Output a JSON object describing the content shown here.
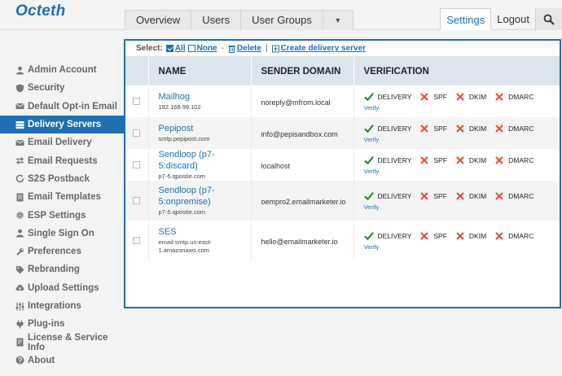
{
  "app": {
    "name": "Octeth"
  },
  "nav": {
    "items": [
      "Overview",
      "Users",
      "User Groups"
    ],
    "dropdown_glyph": "▼",
    "settings": "Settings",
    "logout": "Logout"
  },
  "sidebar": {
    "active_index": 3,
    "items": [
      {
        "label": "Admin Account",
        "icon": "user-icon"
      },
      {
        "label": "Security",
        "icon": "shield-icon"
      },
      {
        "label": "Default Opt-in Email",
        "icon": "envelope-icon"
      },
      {
        "label": "Delivery Servers",
        "icon": "server-icon"
      },
      {
        "label": "Email Delivery",
        "icon": "envelope-icon"
      },
      {
        "label": "Email Requests",
        "icon": "arrows-icon"
      },
      {
        "label": "S2S Postback",
        "icon": "refresh-icon"
      },
      {
        "label": "Email Templates",
        "icon": "document-icon"
      },
      {
        "label": "ESP Settings",
        "icon": "gear-icon"
      },
      {
        "label": "Single Sign On",
        "icon": "user-icon"
      },
      {
        "label": "Preferences",
        "icon": "wrench-icon"
      },
      {
        "label": "Rebranding",
        "icon": "tag-icon"
      },
      {
        "label": "Upload Settings",
        "icon": "cloud-upload-icon"
      },
      {
        "label": "Integrations",
        "icon": "sliders-icon"
      },
      {
        "label": "Plug-ins",
        "icon": "plug-icon"
      },
      {
        "label": "License & Service Info",
        "icon": "license-icon"
      },
      {
        "label": "About",
        "icon": "question-icon"
      }
    ]
  },
  "toolbar": {
    "select_label": "Select:",
    "all": "All",
    "none": "None",
    "dash": "-",
    "delete": "Delete",
    "pipe": "|",
    "create": "Create delivery server"
  },
  "table": {
    "headers": {
      "name": "NAME",
      "sender": "SENDER DOMAIN",
      "verification": "VERIFICATION"
    },
    "verify_link": "Verify",
    "check_labels": [
      "DELIVERY",
      "SPF",
      "DKIM",
      "DMARC"
    ],
    "rows": [
      {
        "name": "Mailhog",
        "host": "192.168.99.102",
        "sender": "noreply@mfrom.local",
        "checks": [
          true,
          false,
          false,
          false
        ]
      },
      {
        "name": "Pepipost",
        "host": "smtp.pepipost.com",
        "sender": "info@pepisandbox.com",
        "checks": [
          true,
          false,
          false,
          false
        ]
      },
      {
        "name": "Sendloop (p7-5:discard)",
        "host": "p7-5.qpostie.com",
        "sender": "localhost",
        "checks": [
          true,
          false,
          false,
          false
        ]
      },
      {
        "name": "Sendloop (p7-5:onpremise)",
        "host": "p7-5.qpostie.com",
        "sender": "oempro2.emailmarketer.io",
        "checks": [
          true,
          false,
          false,
          false
        ]
      },
      {
        "name": "SES",
        "host": "email-smtp.us-east-1.amazonaws.com",
        "sender": "hello@emailmarketer.io",
        "checks": [
          true,
          false,
          false,
          false
        ]
      }
    ]
  },
  "colors": {
    "brand": "#1f6fb2",
    "pass": "#2e8b2e",
    "fail": "#e8503a"
  }
}
